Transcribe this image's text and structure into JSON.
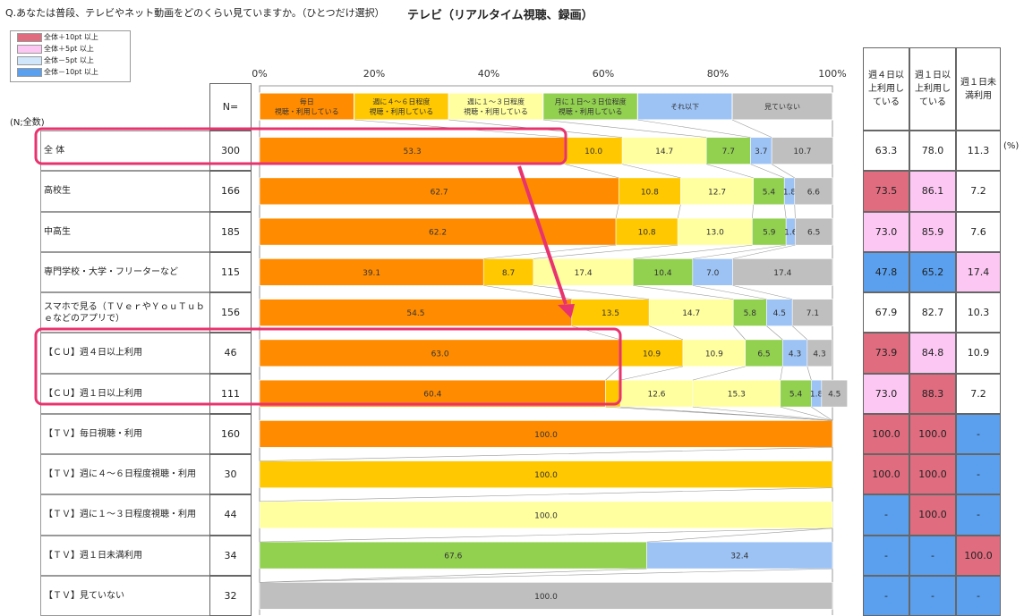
{
  "question": "Q.あなたは普段、テレビやネット動画をどのくらい見ていますか。（ひとつだけ選択）",
  "title": "テレビ（リアルタイム視聴、録画）",
  "unit_note": "(N;全数)",
  "n_header": "N=",
  "pct_unit": "(%)",
  "legend": [
    {
      "label": "全体＋10pt 以上",
      "color": "#e06c7f"
    },
    {
      "label": "全体＋5pt 以上",
      "color": "#fcc8f3"
    },
    {
      "label": "全体－5pt 以上",
      "color": "#cfe6fb"
    },
    {
      "label": "全体－10pt 以上",
      "color": "#5aa0ee"
    }
  ],
  "summary_headers": [
    "週４日以上利用している",
    "週１日以上利用している",
    "週１日未満利用"
  ],
  "chart_data": {
    "type": "bar",
    "orientation": "horizontal",
    "stacked": true,
    "xlim": [
      0,
      100
    ],
    "x_ticks": [
      "0%",
      "20%",
      "40%",
      "60%",
      "80%",
      "100%"
    ],
    "series": [
      {
        "name": "毎日視聴・利用している",
        "color": "#ff8c00"
      },
      {
        "name": "週に４～６日程度視聴・利用している",
        "color": "#ffc800"
      },
      {
        "name": "週に１～３日程度視聴・利用している",
        "color": "#ffffa0"
      },
      {
        "name": "月に１日～３日位程度視聴・利用している",
        "color": "#92d050"
      },
      {
        "name": "それ以下",
        "color": "#9dc3f5"
      },
      {
        "name": "見ていない",
        "color": "#bfbfbf"
      }
    ],
    "rows": [
      {
        "label": "全 体",
        "n": "300",
        "values": [
          53.3,
          10.0,
          14.7,
          7.7,
          3.7,
          10.7
        ],
        "labels": [
          "53.3",
          "10.0",
          "14.7",
          "7.7",
          "3.7",
          "10.7"
        ],
        "summary": [
          "63.3",
          "78.0",
          "11.3"
        ],
        "summary_flags": [
          "",
          "",
          ""
        ],
        "highlight": true
      },
      {
        "label": "高校生",
        "n": "166",
        "values": [
          62.7,
          10.8,
          12.7,
          5.4,
          1.8,
          6.6
        ],
        "labels": [
          "62.7",
          "10.8",
          "12.7",
          "5.4",
          "1.8",
          "6.6"
        ],
        "summary": [
          "73.5",
          "86.1",
          "7.2"
        ],
        "summary_flags": [
          "plus10",
          "plus5",
          ""
        ]
      },
      {
        "label": "中高生",
        "n": "185",
        "values": [
          62.2,
          10.8,
          13.0,
          5.9,
          1.6,
          6.5
        ],
        "labels": [
          "62.2",
          "10.8",
          "13.0",
          "5.9",
          "1.6",
          "6.5"
        ],
        "summary": [
          "73.0",
          "85.9",
          "7.6"
        ],
        "summary_flags": [
          "plus5",
          "plus5",
          ""
        ]
      },
      {
        "label": "専門学校・大学・フリーターなど",
        "n": "115",
        "values": [
          39.1,
          8.7,
          17.4,
          10.4,
          7.0,
          17.4
        ],
        "labels": [
          "39.1",
          "8.7",
          "17.4",
          "10.4",
          "7.0",
          "17.4"
        ],
        "summary": [
          "47.8",
          "65.2",
          "17.4"
        ],
        "summary_flags": [
          "minus10",
          "minus10",
          "plus5"
        ]
      },
      {
        "label": "スマホで見る（ＴＶｅｒやＹｏｕＴｕｂｅなどのアプリで）",
        "n": "156",
        "values": [
          54.5,
          13.5,
          14.7,
          5.8,
          4.5,
          7.1
        ],
        "labels": [
          "54.5",
          "13.5",
          "14.7",
          "5.8",
          "4.5",
          "7.1"
        ],
        "summary": [
          "67.9",
          "82.7",
          "10.3"
        ],
        "summary_flags": [
          "",
          "",
          ""
        ]
      },
      {
        "label": "【ＣＵ】週４日以上利用",
        "n": "46",
        "values": [
          63.0,
          10.9,
          10.9,
          6.5,
          4.3,
          4.3
        ],
        "labels": [
          "63.0",
          "10.9",
          "10.9",
          "6.5",
          "4.3",
          "4.3"
        ],
        "summary": [
          "73.9",
          "84.8",
          "10.9"
        ],
        "summary_flags": [
          "plus10",
          "plus5",
          ""
        ],
        "highlight": true
      },
      {
        "label": "【ＣＵ】週１日以上利用",
        "n": "111",
        "values": [
          60.4,
          2.6,
          12.6,
          15.3,
          5.4,
          1.8,
          4.5
        ],
        "labels": [
          "60.4",
          "",
          "12.6",
          "15.3",
          "5.4",
          "1.8",
          "4.5"
        ],
        "segment_series": [
          0,
          1,
          2,
          2,
          3,
          4,
          5
        ],
        "summary": [
          "73.0",
          "88.3",
          "7.2"
        ],
        "summary_flags": [
          "plus5",
          "plus10",
          ""
        ],
        "highlight": true
      },
      {
        "label": "【ＴＶ】毎日視聴・利用",
        "n": "160",
        "values": [
          100.0,
          0,
          0,
          0,
          0,
          0
        ],
        "labels": [
          "100.0",
          "",
          "",
          "",
          "",
          ""
        ],
        "summary": [
          "100.0",
          "100.0",
          "-"
        ],
        "summary_flags": [
          "plus10",
          "plus10",
          "minus10"
        ]
      },
      {
        "label": "【ＴＶ】週に４～６日程度視聴・利用",
        "n": "30",
        "values": [
          0,
          100.0,
          0,
          0,
          0,
          0
        ],
        "labels": [
          "",
          "100.0",
          "",
          "",
          "",
          ""
        ],
        "summary": [
          "100.0",
          "100.0",
          "-"
        ],
        "summary_flags": [
          "plus10",
          "plus10",
          "minus10"
        ]
      },
      {
        "label": "【ＴＶ】週に１～３日程度視聴・利用",
        "n": "44",
        "values": [
          0,
          0,
          100.0,
          0,
          0,
          0
        ],
        "labels": [
          "",
          "",
          "100.0",
          "",
          "",
          ""
        ],
        "summary": [
          "-",
          "100.0",
          "-"
        ],
        "summary_flags": [
          "minus10",
          "plus10",
          "minus10"
        ]
      },
      {
        "label": "【ＴＶ】週１日未満利用",
        "n": "34",
        "values": [
          0,
          0,
          0,
          67.6,
          32.4,
          0
        ],
        "labels": [
          "",
          "",
          "",
          "67.6",
          "32.4",
          ""
        ],
        "summary": [
          "-",
          "-",
          "100.0"
        ],
        "summary_flags": [
          "minus10",
          "minus10",
          "plus10"
        ]
      },
      {
        "label": "【ＴＶ】見ていない",
        "n": "32",
        "values": [
          0,
          0,
          0,
          0,
          0,
          100.0
        ],
        "labels": [
          "",
          "",
          "",
          "",
          "",
          "100.0"
        ],
        "summary": [
          "-",
          "-",
          "-"
        ],
        "summary_flags": [
          "minus10",
          "minus10",
          "minus10"
        ]
      }
    ]
  }
}
